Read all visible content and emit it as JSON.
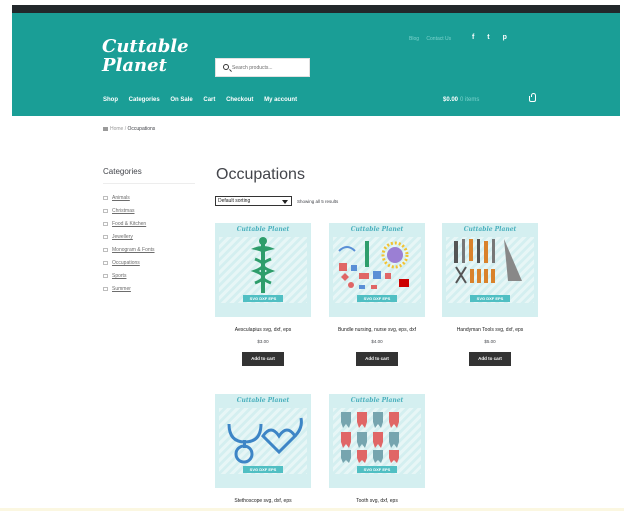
{
  "brand": {
    "line1": "Cuttable",
    "line2": "Planet",
    "color": "#1a9e96"
  },
  "search": {
    "placeholder": "Search products..."
  },
  "header_links": [
    "Blog",
    "Contact Us"
  ],
  "social_icons": [
    "facebook-icon",
    "twitter-icon",
    "pinterest-icon"
  ],
  "social_glyphs": [
    "f",
    "t",
    "p"
  ],
  "nav": [
    "Shop",
    "Categories",
    "On Sale",
    "Cart",
    "Checkout",
    "My account"
  ],
  "cart": {
    "amount": "$0.00",
    "items": "0 items"
  },
  "breadcrumb": {
    "home": "Home",
    "separator": "/",
    "current": "Occupations"
  },
  "sidebar": {
    "title": "Categories",
    "items": [
      "Animals",
      "Christmas",
      "Food & Kitchen",
      "Jewellery",
      "Monogram & Fonts",
      "Occupations",
      "Sports",
      "Summer"
    ]
  },
  "main": {
    "title": "Occupations",
    "sort": "Default sorting",
    "result_count": "Showing all 5 results"
  },
  "thumb_brand": "Cuttable Planet",
  "thumb_formats": "SVG  DXF  EPS",
  "products": [
    {
      "name": "Aesculapius svg, dxf, eps",
      "price": "$3.00",
      "button": "Add to cart",
      "icon": "caduceus-icon"
    },
    {
      "name": "Bundle nursing, nurse svg, eps, dxf",
      "price": "$4.00",
      "button": "Add to cart",
      "icon": "nursing-bundle-icon"
    },
    {
      "name": "Handyman Tools svg, dxf, eps",
      "price": "$5.00",
      "button": "Add to cart",
      "icon": "tools-icon"
    },
    {
      "name": "Stethoscope svg, dxf, eps",
      "price": "",
      "button": "",
      "icon": "stethoscope-icon"
    },
    {
      "name": "Tooth svg, dxf, eps",
      "price": "",
      "button": "",
      "icon": "tooth-icon"
    }
  ],
  "colors": {
    "header_bg": "#1a9e96",
    "topbar": "#22282b",
    "button_bg": "#333333",
    "thumb_bg": "#d4eff0"
  }
}
